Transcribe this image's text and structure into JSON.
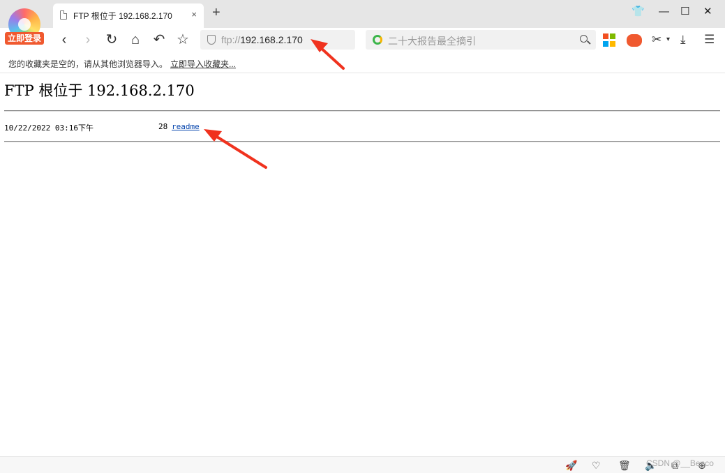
{
  "browser": {
    "login_badge": "立即登录",
    "tab": {
      "title": "FTP 根位于 192.168.2.170",
      "close_glyph": "×"
    },
    "new_tab_glyph": "+",
    "window_controls": {
      "skin": "👕",
      "minimize": "—",
      "maximize": "☐",
      "close": "✕"
    },
    "toolbar": {
      "back": "‹",
      "forward": "›",
      "reload": "↻",
      "home": "⌂",
      "undo": "↶",
      "favorite": "☆",
      "address": {
        "protocol": "ftp://",
        "host": "192.168.2.170"
      },
      "search_placeholder": "二十大报告最全摘引",
      "cut": "✂",
      "cut_dropdown": "▾",
      "download": "⤓",
      "menu": "☰"
    },
    "bookmarks": {
      "empty_message": "您的收藏夹是空的，请从其他浏览器导入。",
      "import_link": "立即导入收藏夹..."
    },
    "colors": {
      "accent": "#f0592f",
      "link": "#0645ad",
      "annotation_arrow": "#f0321e"
    },
    "icons": [
      "logo-icon",
      "document-icon",
      "shield-icon",
      "search-engine-icon",
      "search-icon",
      "microsoft-icon",
      "game-icon",
      "scissors-icon",
      "download-icon",
      "menu-icon",
      "rocket-icon",
      "heart-icon",
      "trash-icon",
      "speaker-icon",
      "copy-icon",
      "zoom-icon"
    ]
  },
  "page": {
    "title": "FTP 根位于 192.168.2.170",
    "listing": [
      {
        "date": "10/22/2022 03:16下午",
        "size": "28",
        "name": "readme"
      }
    ]
  },
  "statusbar": {
    "rocket": "🚀",
    "heart": "♡",
    "trash": "🗑",
    "speaker": "🔈",
    "copy": "⧉",
    "zoom": "⊕",
    "watermark": "CSDN @__Benco"
  }
}
